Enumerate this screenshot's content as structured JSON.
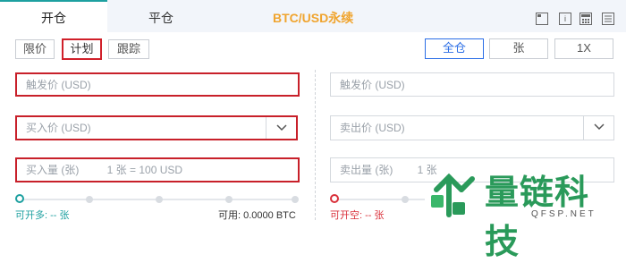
{
  "header": {
    "tabs": [
      {
        "label": "开仓"
      },
      {
        "label": "平仓"
      }
    ],
    "title": "BTC/USD永续"
  },
  "order_types": [
    "限价",
    "计划",
    "跟踪"
  ],
  "right_controls": {
    "margin_mode": "全仓",
    "unit": "张",
    "leverage": "1X"
  },
  "buy_side": {
    "trigger_placeholder": "触发价 (USD)",
    "price_placeholder": "买入价 (USD)",
    "amount_placeholder": "买入量 (张)",
    "amount_hint": "1 张 = 100 USD",
    "available_label": "可开多: -- 张",
    "balance_label": "可用: 0.0000 BTC"
  },
  "sell_side": {
    "trigger_placeholder": "触发价 (USD)",
    "price_placeholder": "卖出价 (USD)",
    "amount_placeholder": "卖出量 (张)",
    "amount_hint_partial": "1 张",
    "available_label": "可开空: -- 张"
  },
  "watermark": {
    "brand": "量链科技",
    "site": "QFSP.NET"
  },
  "colors": {
    "accent_teal": "#1da0a0",
    "title_orange": "#f0a42e",
    "highlight_red": "#c8202a",
    "blue": "#2b6ee6",
    "sell_red": "#d9303a"
  }
}
